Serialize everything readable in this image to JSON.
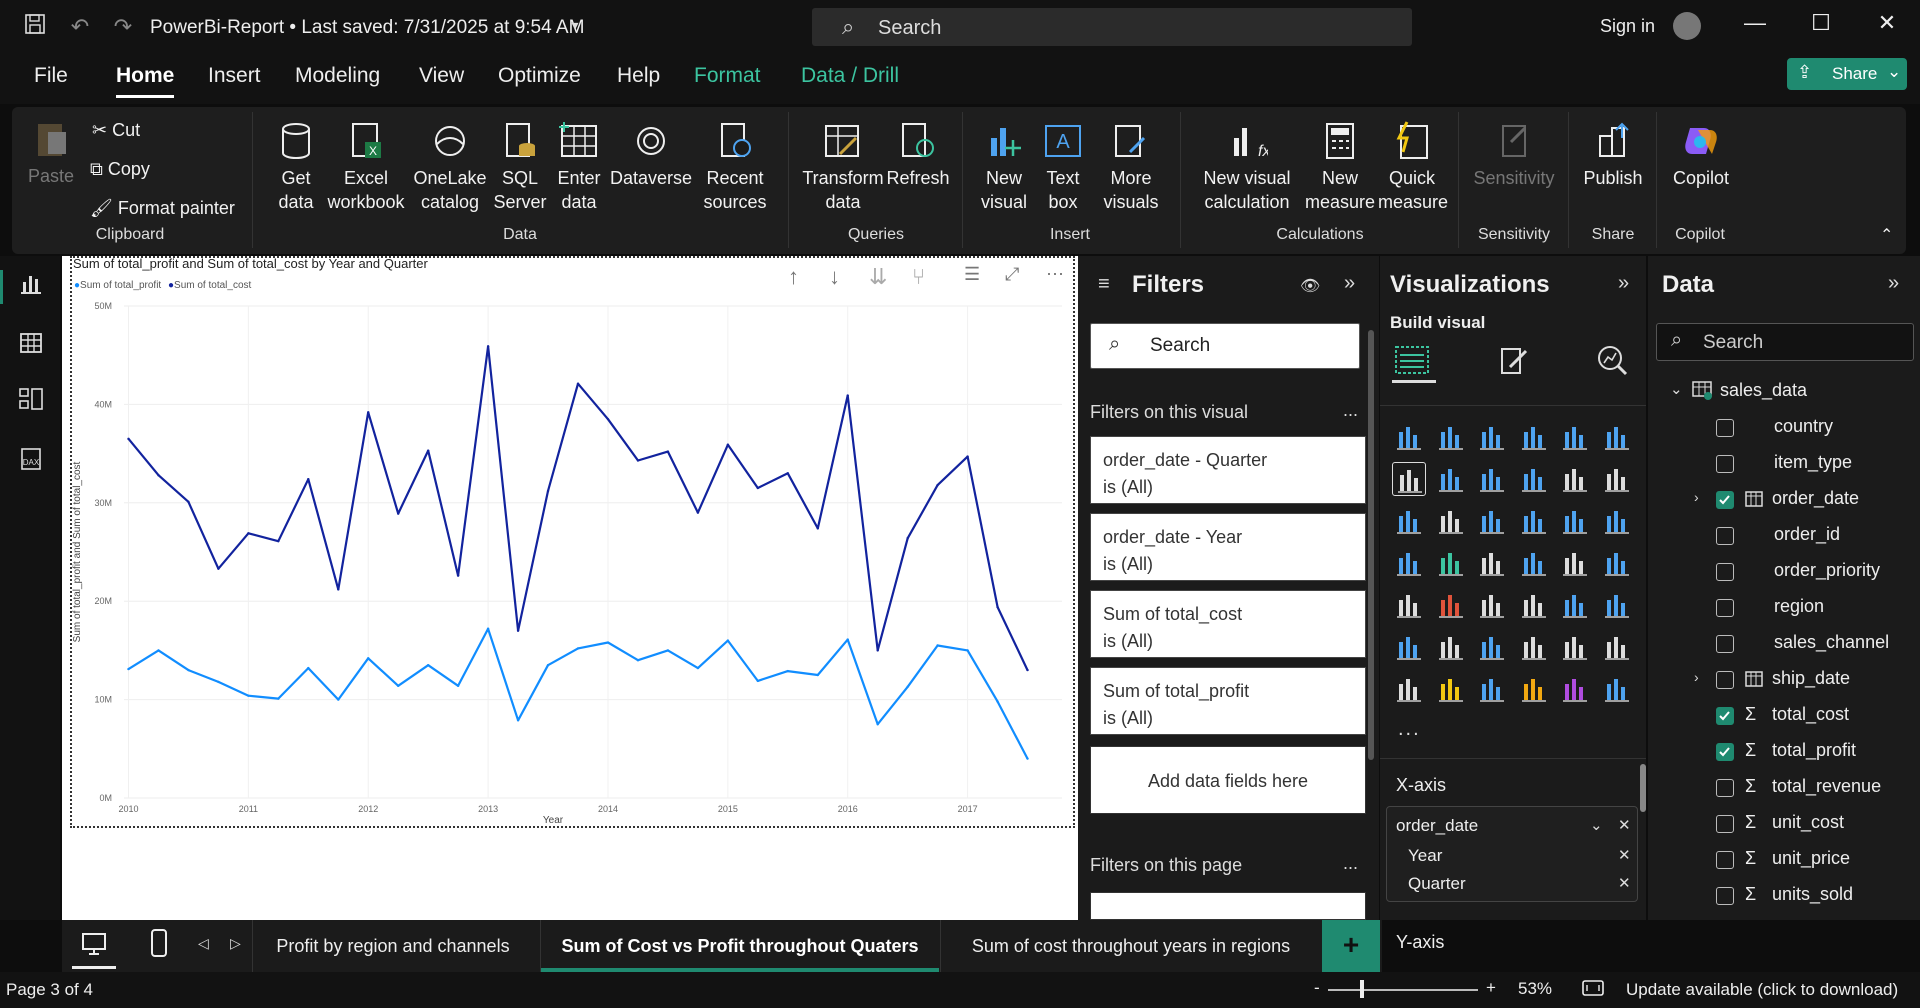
{
  "titlebar": {
    "title": "PowerBi-Report • Last saved: 7/31/2025 at 9:54 AM",
    "search_placeholder": "Search",
    "signin": "Sign in"
  },
  "menu": [
    "File",
    "Home",
    "Insert",
    "Modeling",
    "View",
    "Optimize",
    "Help",
    "Format",
    "Data / Drill"
  ],
  "share_label": "Share",
  "ribbon": {
    "clipboard": {
      "paste": "Paste",
      "cut": "Cut",
      "copy": "Copy",
      "format_painter": "Format painter",
      "group": "Clipboard"
    },
    "data": {
      "get_data": "Get data",
      "excel": "Excel workbook",
      "onelake": "OneLake catalog",
      "sql": "SQL Server",
      "enter": "Enter data",
      "dataverse": "Dataverse",
      "recent": "Recent sources",
      "group": "Data"
    },
    "queries": {
      "transform": "Transform data",
      "refresh": "Refresh",
      "group": "Queries"
    },
    "insert": {
      "new_visual": "New visual",
      "text_box": "Text box",
      "more_visuals": "More visuals",
      "group": "Insert"
    },
    "calculations": {
      "new_visual_calc": "New visual calculation",
      "new_measure": "New measure",
      "quick_measure": "Quick measure",
      "group": "Calculations"
    },
    "sensitivity": {
      "label": "Sensitivity",
      "group": "Sensitivity"
    },
    "share": {
      "publish": "Publish",
      "group": "Share"
    },
    "copilot": {
      "label": "Copilot",
      "group": "Copilot"
    }
  },
  "visual": {
    "title": "Sum of total_profit and Sum of total_cost by Year and Quarter",
    "legend": [
      "Sum of total_profit",
      "Sum of total_cost"
    ]
  },
  "chart_data": {
    "type": "line",
    "title": "Sum of total_profit and Sum of total_cost by Year and Quarter",
    "xlabel": "Year",
    "ylabel": "Sum of total_profit and Sum of total_cost",
    "x_ticks": [
      "2010",
      "2011",
      "2012",
      "2013",
      "2014",
      "2015",
      "2016",
      "2017"
    ],
    "y_ticks": [
      "0M",
      "10M",
      "20M",
      "30M",
      "40M",
      "50M"
    ],
    "ylim": [
      0,
      50
    ],
    "grid": true,
    "legend_position": "top-left",
    "series": [
      {
        "name": "Sum of total_profit",
        "color": "#118dff",
        "values": [
          13.1,
          15.0,
          13.0,
          11.8,
          10.4,
          10.1,
          13.2,
          10.0,
          14.2,
          11.4,
          13.5,
          11.4,
          17.2,
          7.9,
          13.5,
          15.2,
          15.8,
          14.0,
          15.0,
          13.2,
          16.0,
          11.9,
          12.9,
          12.5,
          16.1,
          7.5,
          11.3,
          15.5,
          15.0,
          9.8,
          4.0
        ]
      },
      {
        "name": "Sum of total_cost",
        "color": "#12239e",
        "values": [
          36.5,
          32.8,
          30.1,
          23.3,
          26.9,
          26.1,
          32.4,
          21.2,
          39.2,
          28.9,
          35.3,
          22.6,
          45.9,
          17.0,
          31.2,
          42.1,
          38.5,
          34.3,
          35.2,
          29.0,
          35.9,
          31.5,
          33.0,
          27.4,
          40.9,
          15.0,
          26.4,
          31.8,
          34.7,
          19.4,
          13.0
        ]
      }
    ]
  },
  "filters": {
    "title": "Filters",
    "search": "Search",
    "on_visual": "Filters on this visual",
    "cards": [
      {
        "name": "order_date - Quarter",
        "state": "is (All)"
      },
      {
        "name": "order_date - Year",
        "state": "is (All)"
      },
      {
        "name": "Sum of total_cost",
        "state": "is (All)"
      },
      {
        "name": "Sum of total_profit",
        "state": "is (All)"
      }
    ],
    "add_fields": "Add data fields here",
    "on_page": "Filters on this page",
    "more": "..."
  },
  "visualizations": {
    "title": "Visualizations",
    "build": "Build visual",
    "xaxis": "X-axis",
    "xaxis_field": "order_date",
    "xaxis_sub": [
      "Year",
      "Quarter"
    ],
    "yaxis": "Y-axis",
    "more": "..."
  },
  "data_pane": {
    "title": "Data",
    "search": "Search",
    "table": "sales_data",
    "fields": [
      {
        "label": "country",
        "checked": false,
        "sigma": false
      },
      {
        "label": "item_type",
        "checked": false,
        "sigma": false
      },
      {
        "label": "order_date",
        "checked": true,
        "sigma": false
      },
      {
        "label": "order_id",
        "checked": false,
        "sigma": false
      },
      {
        "label": "order_priority",
        "checked": false,
        "sigma": false
      },
      {
        "label": "region",
        "checked": false,
        "sigma": false
      },
      {
        "label": "sales_channel",
        "checked": false,
        "sigma": false
      },
      {
        "label": "ship_date",
        "checked": false,
        "sigma": false
      },
      {
        "label": "total_cost",
        "checked": true,
        "sigma": true
      },
      {
        "label": "total_profit",
        "checked": true,
        "sigma": true
      },
      {
        "label": "total_revenue",
        "checked": false,
        "sigma": true
      },
      {
        "label": "unit_cost",
        "checked": false,
        "sigma": true
      },
      {
        "label": "unit_price",
        "checked": false,
        "sigma": true
      },
      {
        "label": "units_sold",
        "checked": false,
        "sigma": true
      }
    ]
  },
  "pages": {
    "tabs": [
      "Profit by region and channels",
      "Sum of Cost vs Profit throughout Quaters",
      "Sum of cost throughout years in regions"
    ],
    "active": 1,
    "add": "+"
  },
  "status": {
    "page": "Page 3 of 4",
    "zoom_minus": "-",
    "zoom_plus": "+",
    "zoom": "53%",
    "update": "Update available (click to download)"
  }
}
